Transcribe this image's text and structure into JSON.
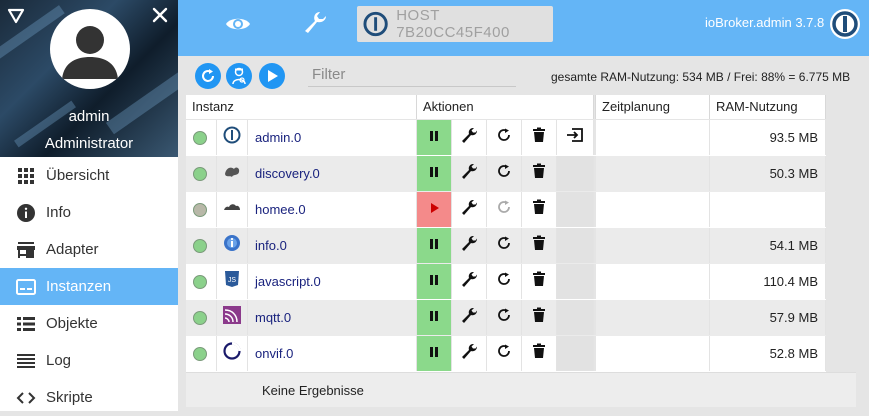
{
  "sidebar": {
    "user_name": "admin",
    "user_role": "Administrator",
    "items": [
      {
        "label": "Übersicht",
        "icon": "grid-icon",
        "active": false
      },
      {
        "label": "Info",
        "icon": "info-icon",
        "active": false
      },
      {
        "label": "Adapter",
        "icon": "store-icon",
        "active": false
      },
      {
        "label": "Instanzen",
        "icon": "instances-icon",
        "active": true
      },
      {
        "label": "Objekte",
        "icon": "list-icon",
        "active": false
      },
      {
        "label": "Log",
        "icon": "log-icon",
        "active": false
      },
      {
        "label": "Skripte",
        "icon": "code-icon",
        "active": false
      }
    ]
  },
  "topbar": {
    "host": "HOST 7B20CC45F400",
    "version": "ioBroker.admin 3.7.8"
  },
  "toolbar": {
    "filter_placeholder": "Filter",
    "ram_summary": "gesamte RAM-Nutzung: 534 MB / Frei: 88% = 6.775 MB"
  },
  "table": {
    "columns": {
      "instance": "Instanz",
      "actions": "Aktionen",
      "schedule": "Zeitplanung",
      "ram": "RAM-Nutzung"
    },
    "rows": [
      {
        "name": "admin.0",
        "status": "running",
        "icon": "iobroker-icon",
        "running": true,
        "ram": "93.5 MB",
        "has_link": true
      },
      {
        "name": "discovery.0",
        "status": "running",
        "icon": "discovery-icon",
        "running": true,
        "ram": "50.3 MB",
        "has_link": false
      },
      {
        "name": "homee.0",
        "status": "stopped",
        "icon": "homee-icon",
        "running": false,
        "ram": "",
        "has_link": false
      },
      {
        "name": "info.0",
        "status": "running",
        "icon": "info-globe-icon",
        "running": true,
        "ram": "54.1 MB",
        "has_link": false
      },
      {
        "name": "javascript.0",
        "status": "running",
        "icon": "javascript-icon",
        "running": true,
        "ram": "110.4 MB",
        "has_link": false
      },
      {
        "name": "mqtt.0",
        "status": "running",
        "icon": "mqtt-icon",
        "running": true,
        "ram": "57.9 MB",
        "has_link": false
      },
      {
        "name": "onvif.0",
        "status": "running",
        "icon": "onvif-icon",
        "running": true,
        "ram": "52.8 MB",
        "has_link": false
      }
    ],
    "no_results": "Keine Ergebnisse"
  },
  "colors": {
    "accent": "#64b5f6",
    "button_blue": "#2196f3",
    "running_green": "#8bd98b",
    "stopped_red": "#f48a8a",
    "status_green": "#8bd18b",
    "status_grey": "#b8b8a8"
  }
}
